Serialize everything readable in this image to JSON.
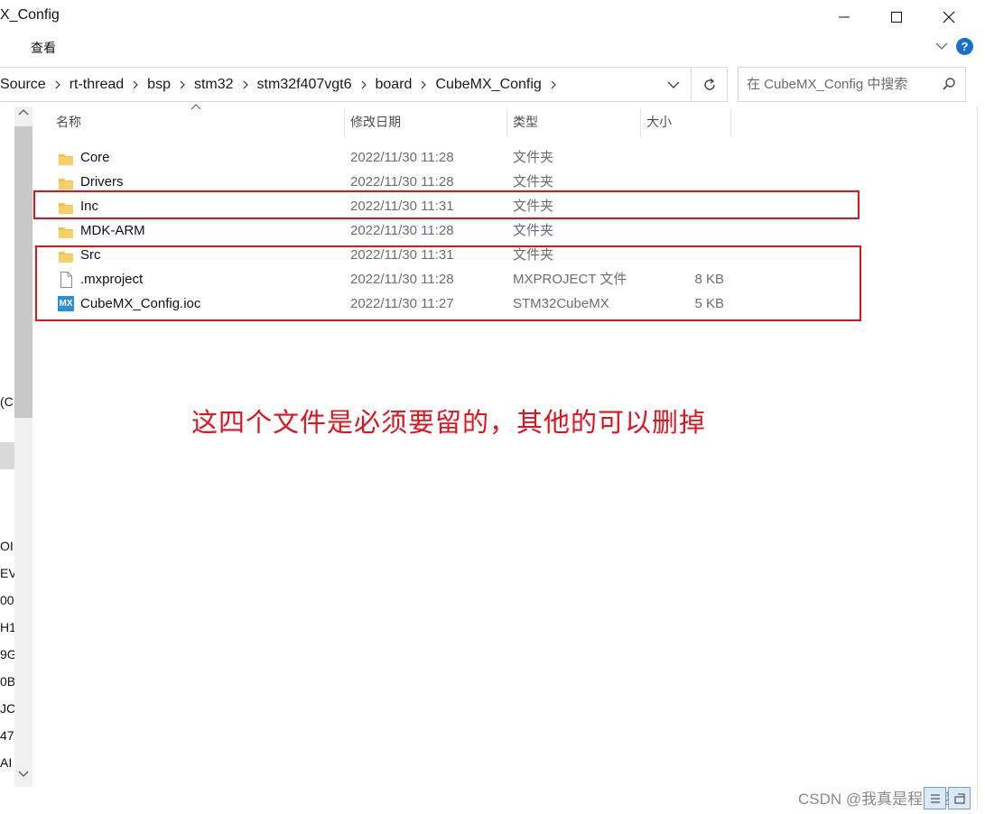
{
  "window": {
    "title": "X_Config",
    "ribbon_tab": "查看",
    "help_label": "?"
  },
  "address": {
    "crumbs": [
      "Source",
      "rt-thread",
      "bsp",
      "stm32",
      "stm32f407vgt6",
      "board",
      "CubeMX_Config"
    ],
    "search_placeholder": "在 CubeMX_Config 中搜索"
  },
  "columns": {
    "name": "名称",
    "date": "修改日期",
    "type": "类型",
    "size": "大小"
  },
  "files": [
    {
      "name": "Core",
      "date": "2022/11/30 11:28",
      "type": "文件夹",
      "size": "",
      "icon": "folder-icon"
    },
    {
      "name": "Drivers",
      "date": "2022/11/30 11:28",
      "type": "文件夹",
      "size": "",
      "icon": "folder-icon"
    },
    {
      "name": "Inc",
      "date": "2022/11/30 11:31",
      "type": "文件夹",
      "size": "",
      "icon": "folder-icon"
    },
    {
      "name": "MDK-ARM",
      "date": "2022/11/30 11:28",
      "type": "文件夹",
      "size": "",
      "icon": "folder-icon"
    },
    {
      "name": "Src",
      "date": "2022/11/30 11:31",
      "type": "文件夹",
      "size": "",
      "icon": "folder-icon"
    },
    {
      "name": ".mxproject",
      "date": "2022/11/30 11:28",
      "type": "MXPROJECT 文件",
      "size": "8 KB",
      "icon": "document-icon"
    },
    {
      "name": "CubeMX_Config.ioc",
      "date": "2022/11/30 11:27",
      "type": "STM32CubeMX",
      "size": "5 KB",
      "icon": "mx-file-icon",
      "icon_text": "MX"
    }
  ],
  "nav_fragments": [
    "(C",
    "OI",
    "EV",
    "00",
    "H1",
    "9G",
    "0B",
    "JC",
    "47",
    "AI"
  ],
  "annotation": "这四个文件是必须要留的，其他的可以删掉",
  "watermark": "CSDN @我真是程序猿",
  "colors": {
    "highlight": "#e0141e",
    "folder": "#f2c14e",
    "accent": "#1a6fd1"
  }
}
